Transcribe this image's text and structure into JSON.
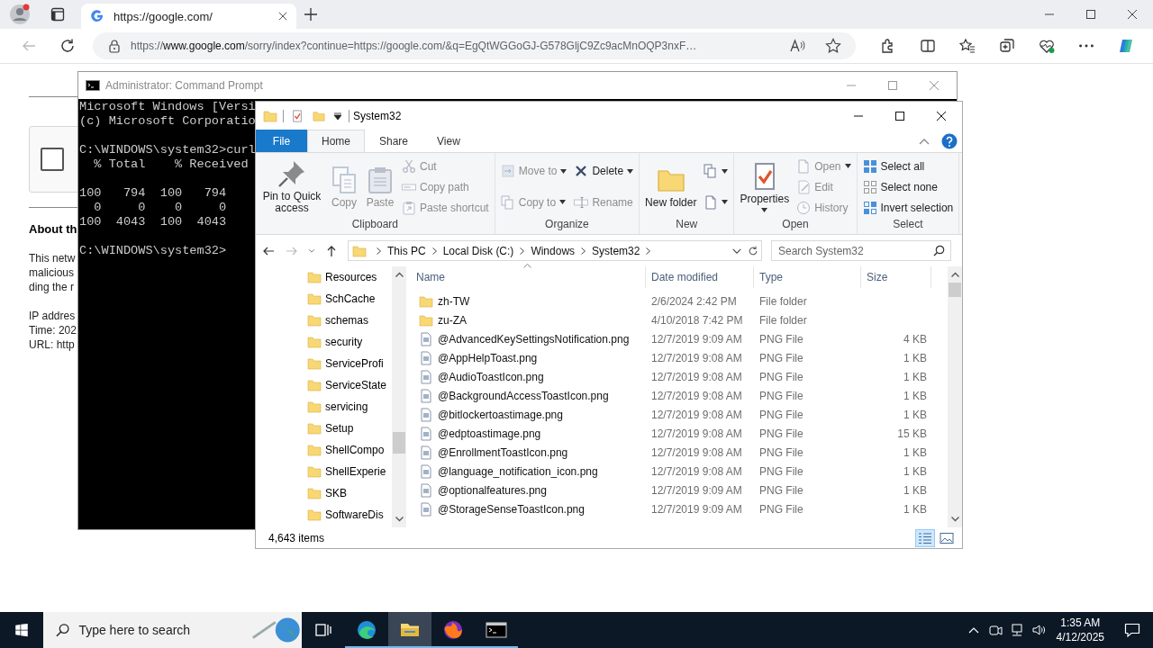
{
  "browser": {
    "tabs": [
      {
        "title": "https://google.com/",
        "selected": true
      }
    ],
    "address": "https://**www.google.com**/sorry/index?continue=https://google.com/&q=EgQtWGGoGJ-G578GljC9Zc9acMnOQP3nxF…",
    "page": {
      "checkbox": {
        "checked": false
      },
      "heading": "About th",
      "paragraph": [
        "This netw",
        "malicious",
        "ding the r"
      ],
      "details": [
        "IP addres",
        "Time: 202",
        "URL: http"
      ]
    }
  },
  "cmd": {
    "title": "Administrator: Command Prompt",
    "blocks": [
      [
        "Microsoft Windows [Versi",
        "(c) Microsoft Corporatio"
      ],
      [
        "C:\\WINDOWS\\system32>curl",
        "  % Total    % Received"
      ],
      [
        "100   794  100   794",
        "  0     0    0     0",
        "100  4043  100  4043"
      ],
      [
        "C:\\WINDOWS\\system32>"
      ]
    ]
  },
  "explorer": {
    "title": "System32",
    "ribbon_tabs": [
      {
        "label": "File",
        "kind": "menu",
        "selected": false
      },
      {
        "label": "Home",
        "kind": "tab",
        "selected": true
      },
      {
        "label": "Share",
        "kind": "tab",
        "selected": false
      },
      {
        "label": "View",
        "kind": "tab",
        "selected": false
      }
    ],
    "ribbon_groups": [
      {
        "label": "Clipboard",
        "columns": [
          [
            {
              "label": "Pin to Quick access",
              "kind": "large",
              "disabled": false,
              "dropdown": false
            }
          ],
          [
            {
              "label": "Copy",
              "kind": "large",
              "disabled": true,
              "dropdown": false
            }
          ],
          [
            {
              "label": "Paste",
              "kind": "large",
              "disabled": true,
              "dropdown": false
            }
          ],
          [
            {
              "label": "Cut",
              "kind": "small",
              "disabled": true,
              "dropdown": false
            },
            {
              "label": "Copy path",
              "kind": "small",
              "disabled": true,
              "dropdown": false
            },
            {
              "label": "Paste shortcut",
              "kind": "small",
              "disabled": true,
              "dropdown": false
            }
          ]
        ]
      },
      {
        "label": "Organize",
        "columns": [
          [
            {
              "label": "Move to",
              "kind": "small",
              "disabled": true,
              "dropdown": true
            },
            {
              "label": "Copy to",
              "kind": "small",
              "disabled": true,
              "dropdown": true
            }
          ],
          [
            {
              "label": "Delete",
              "kind": "small",
              "disabled": false,
              "dropdown": true
            },
            {
              "label": "Rename",
              "kind": "small",
              "disabled": true,
              "dropdown": false
            }
          ]
        ]
      },
      {
        "label": "New",
        "columns": [
          [
            {
              "label": "New folder",
              "kind": "large",
              "disabled": false,
              "dropdown": false
            }
          ],
          [
            {
              "kind": "icon",
              "disabled": false,
              "dropdown": true
            },
            {
              "kind": "icon",
              "disabled": false,
              "dropdown": true
            }
          ]
        ]
      },
      {
        "label": "Open",
        "columns": [
          [
            {
              "label": "Properties",
              "kind": "large",
              "disabled": false,
              "dropdown": true
            }
          ],
          [
            {
              "label": "Open",
              "kind": "small",
              "disabled": true,
              "dropdown": true
            },
            {
              "label": "Edit",
              "kind": "small",
              "disabled": true,
              "dropdown": false
            },
            {
              "label": "History",
              "kind": "small",
              "disabled": true,
              "dropdown": false
            }
          ]
        ]
      },
      {
        "label": "Select",
        "columns": [
          [
            {
              "label": "Select all",
              "kind": "small",
              "disabled": false,
              "dropdown": false
            },
            {
              "label": "Select none",
              "kind": "small",
              "disabled": false,
              "dropdown": false
            },
            {
              "label": "Invert selection",
              "kind": "small",
              "disabled": false,
              "dropdown": false
            }
          ]
        ]
      }
    ],
    "breadcrumb": [
      "This PC",
      "Local Disk (C:)",
      "Windows",
      "System32"
    ],
    "search": {
      "placeholder": "Search System32"
    },
    "tree": [
      "Resources",
      "SchCache",
      "schemas",
      "security",
      "ServiceProfi",
      "ServiceState",
      "servicing",
      "Setup",
      "ShellCompo",
      "ShellExperie",
      "SKB",
      "SoftwareDis"
    ],
    "columns": [
      "Name",
      "Date modified",
      "Type",
      "Size"
    ],
    "rows": [
      {
        "kind": "folder",
        "name": "zh-TW",
        "date": "2/6/2024 2:42 PM",
        "type": "File folder"
      },
      {
        "kind": "folder",
        "name": "zu-ZA",
        "date": "4/10/2018 7:42 PM",
        "type": "File folder"
      },
      {
        "kind": "file",
        "name": "@AdvancedKeySettingsNotification.png",
        "date": "12/7/2019 9:09 AM",
        "type": "PNG File",
        "size": "4 KB"
      },
      {
        "kind": "file",
        "name": "@AppHelpToast.png",
        "date": "12/7/2019 9:08 AM",
        "type": "PNG File",
        "size": "1 KB"
      },
      {
        "kind": "file",
        "name": "@AudioToastIcon.png",
        "date": "12/7/2019 9:08 AM",
        "type": "PNG File",
        "size": "1 KB"
      },
      {
        "kind": "file",
        "name": "@BackgroundAccessToastIcon.png",
        "date": "12/7/2019 9:08 AM",
        "type": "PNG File",
        "size": "1 KB"
      },
      {
        "kind": "file",
        "name": "@bitlockertoastimage.png",
        "date": "12/7/2019 9:08 AM",
        "type": "PNG File",
        "size": "1 KB"
      },
      {
        "kind": "file",
        "name": "@edptoastimage.png",
        "date": "12/7/2019 9:08 AM",
        "type": "PNG File",
        "size": "15 KB"
      },
      {
        "kind": "file",
        "name": "@EnrollmentToastIcon.png",
        "date": "12/7/2019 9:08 AM",
        "type": "PNG File",
        "size": "1 KB"
      },
      {
        "kind": "file",
        "name": "@language_notification_icon.png",
        "date": "12/7/2019 9:08 AM",
        "type": "PNG File",
        "size": "1 KB"
      },
      {
        "kind": "file",
        "name": "@optionalfeatures.png",
        "date": "12/7/2019 9:09 AM",
        "type": "PNG File",
        "size": "1 KB"
      },
      {
        "kind": "file",
        "name": "@StorageSenseToastIcon.png",
        "date": "12/7/2019 9:09 AM",
        "type": "PNG File",
        "size": "1 KB"
      }
    ],
    "status": "4,643 items",
    "views": [
      {
        "kind": "details",
        "selected": true
      },
      {
        "kind": "large-icons",
        "selected": false
      }
    ]
  },
  "taskbar": {
    "search": {
      "placeholder": "Type here to search"
    },
    "apps": [
      {
        "kind": "edge",
        "running": true,
        "selected": false
      },
      {
        "kind": "explorer",
        "running": true,
        "selected": true
      },
      {
        "kind": "firefox",
        "running": true,
        "selected": false
      },
      {
        "kind": "terminal",
        "running": true,
        "selected": false
      }
    ],
    "time": "1:35 AM",
    "date": "4/12/2025"
  }
}
